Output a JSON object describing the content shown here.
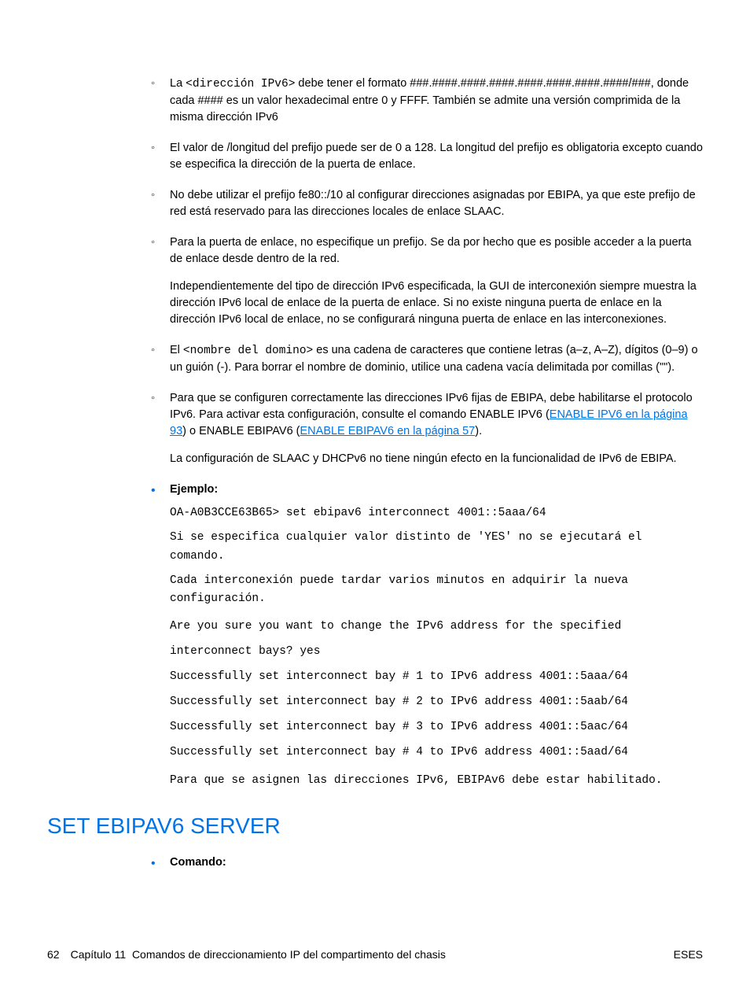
{
  "bullets_nested": [
    {
      "p1_pre": "La ",
      "p1_mono": "<dirección IPv6>",
      "p1_post": " debe tener el formato ###.####.####.####.####.####.####.####/###, donde cada #### es un valor hexadecimal entre 0 y FFFF. También se admite una versión comprimida de la misma dirección IPv6"
    },
    {
      "p1": "El valor de /longitud del prefijo puede ser de 0 a 128. La longitud del prefijo es obligatoria excepto cuando se especifica la dirección de la puerta de enlace."
    },
    {
      "p1": "No debe utilizar el prefijo fe80::/10 al configurar direcciones asignadas por EBIPA, ya que este prefijo de red está reservado para las direcciones locales de enlace SLAAC."
    },
    {
      "p1": "Para la puerta de enlace, no especifique un prefijo. Se da por hecho que es posible acceder a la puerta de enlace desde dentro de la red.",
      "p2": "Independientemente del tipo de dirección IPv6 especificada, la GUI de interconexión siempre muestra la dirección IPv6 local de enlace de la puerta de enlace. Si no existe ninguna puerta de enlace en la dirección IPv6 local de enlace, no se configurará ninguna puerta de enlace en las interconexiones."
    },
    {
      "p1_pre": "El ",
      "p1_mono": "<nombre del domino>",
      "p1_post": " es una cadena de caracteres que contiene letras (a–z, A–Z), dígitos (0–9) o un guión (-). Para borrar el nombre de dominio, utilice una cadena vacía delimitada por comillas (\"\")."
    },
    {
      "p1_pre": "Para que se configuren correctamente las direcciones IPv6 fijas de EBIPA, debe habilitarse el protocolo IPv6. Para activar esta configuración, consulte el comando ENABLE IPV6 (",
      "link1": "ENABLE IPV6 en la página 93",
      "p1_mid": ") o ENABLE EBIPAV6 (",
      "link2": "ENABLE EBIPAV6 en la página 57",
      "p1_post": ").",
      "p2": "La configuración de SLAAC y DHCPv6 no tiene ningún efecto en la funcionalidad de IPv6 de EBIPA."
    }
  ],
  "ejemplo_label": "Ejemplo:",
  "terminal1": "OA-A0B3CCE63B65> set ebipav6 interconnect 4001::5aaa/64",
  "terminal2": "Si se especifica cualquier valor distinto de 'YES' no se ejecutará el comando.",
  "terminal3": "Cada interconexión puede tardar varios minutos en adquirir la nueva configuración.",
  "terminal_block": "Are you sure you want to change the IPv6 address for the specified\ninterconnect bays? yes\nSuccessfully set interconnect bay # 1 to IPv6 address 4001::5aaa/64\nSuccessfully set interconnect bay # 2 to IPv6 address 4001::5aab/64\nSuccessfully set interconnect bay # 3 to IPv6 address 4001::5aac/64\nSuccessfully set interconnect bay # 4 to IPv6 address 4001::5aad/64",
  "terminal4": "Para que se asignen las direcciones IPv6, EBIPAv6 debe estar habilitado.",
  "section_title": "SET EBIPAV6 SERVER",
  "comando_label": "Comando:",
  "footer": {
    "page": "62",
    "chapter_prefix": "Capítulo 11",
    "chapter_title": "Comandos de direccionamiento IP del compartimento del chasis",
    "right": "ESES"
  }
}
